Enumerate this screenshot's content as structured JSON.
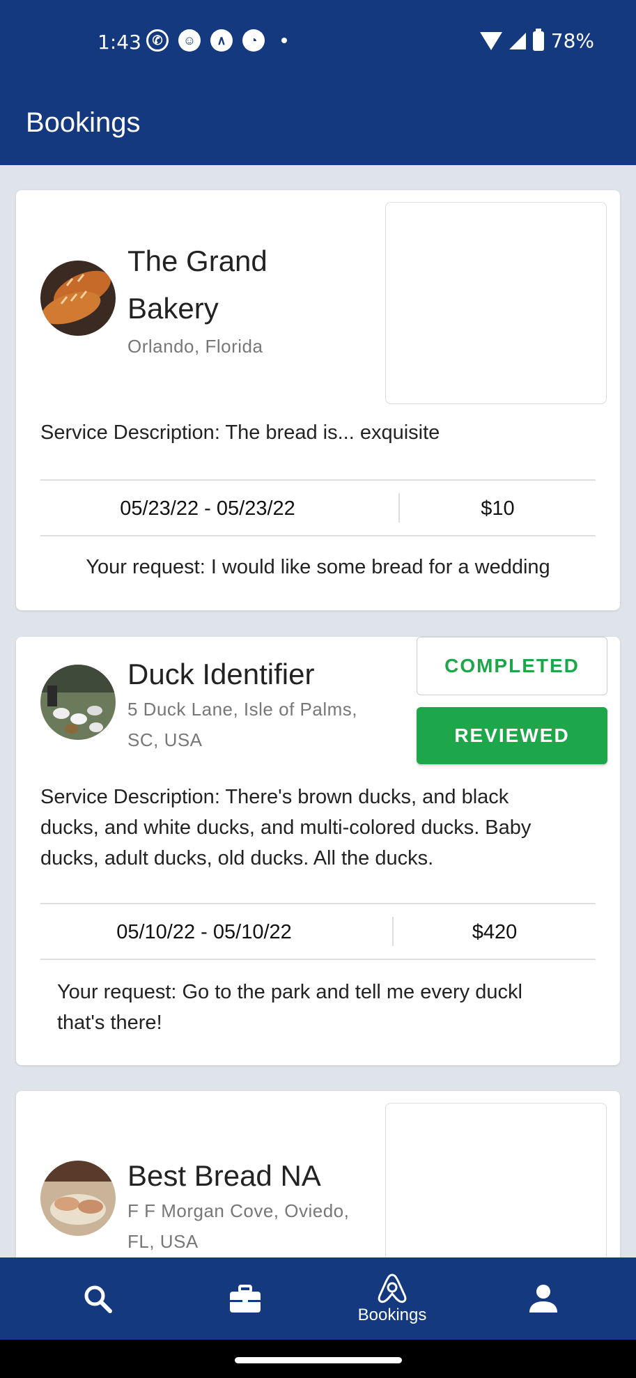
{
  "status_bar": {
    "time": "1:43",
    "battery": "78%",
    "notification_icons": [
      "whatsapp-icon",
      "snapchat-icon",
      "app-icon",
      "taco-bell-icon"
    ]
  },
  "app_bar": {
    "title": "Bookings"
  },
  "bookings": [
    {
      "name_line1": "The Grand",
      "name_line2": "Bakery",
      "location": "Orlando, Florida",
      "description": "Service Description: The bread is... exquisite",
      "dates": "05/23/22 - 05/23/22",
      "price": "$10",
      "request": "Your request: I would like some bread for a wedding"
    },
    {
      "name": "Duck Identifier",
      "location_line1": "5 Duck Lane, Isle of Palms,",
      "location_line2": "SC, USA",
      "status": "COMPLETED",
      "review_status": "REVIEWED",
      "description_line1": "Service Description: There's brown ducks, and black",
      "description_line2": "ducks, and white ducks, and multi-colored ducks. Baby",
      "description_line3": "ducks, adult ducks, old ducks. All the ducks.",
      "dates": "05/10/22 - 05/10/22",
      "price": "$420",
      "request_line1": "Your request: Go to the park and tell me every duckl",
      "request_line2": "that's there!"
    },
    {
      "name": "Best Bread NA",
      "location_line1": "F F Morgan Cove, Oviedo,",
      "location_line2": "FL, USA"
    }
  ],
  "bottom_nav": [
    {
      "icon": "search-icon",
      "label": ""
    },
    {
      "icon": "briefcase-icon",
      "label": ""
    },
    {
      "icon": "bookings-icon",
      "label": "Bookings"
    },
    {
      "icon": "person-icon",
      "label": ""
    }
  ],
  "colors": {
    "primary": "#14397f",
    "success": "#1ea64a",
    "background": "#dfe4ea"
  }
}
